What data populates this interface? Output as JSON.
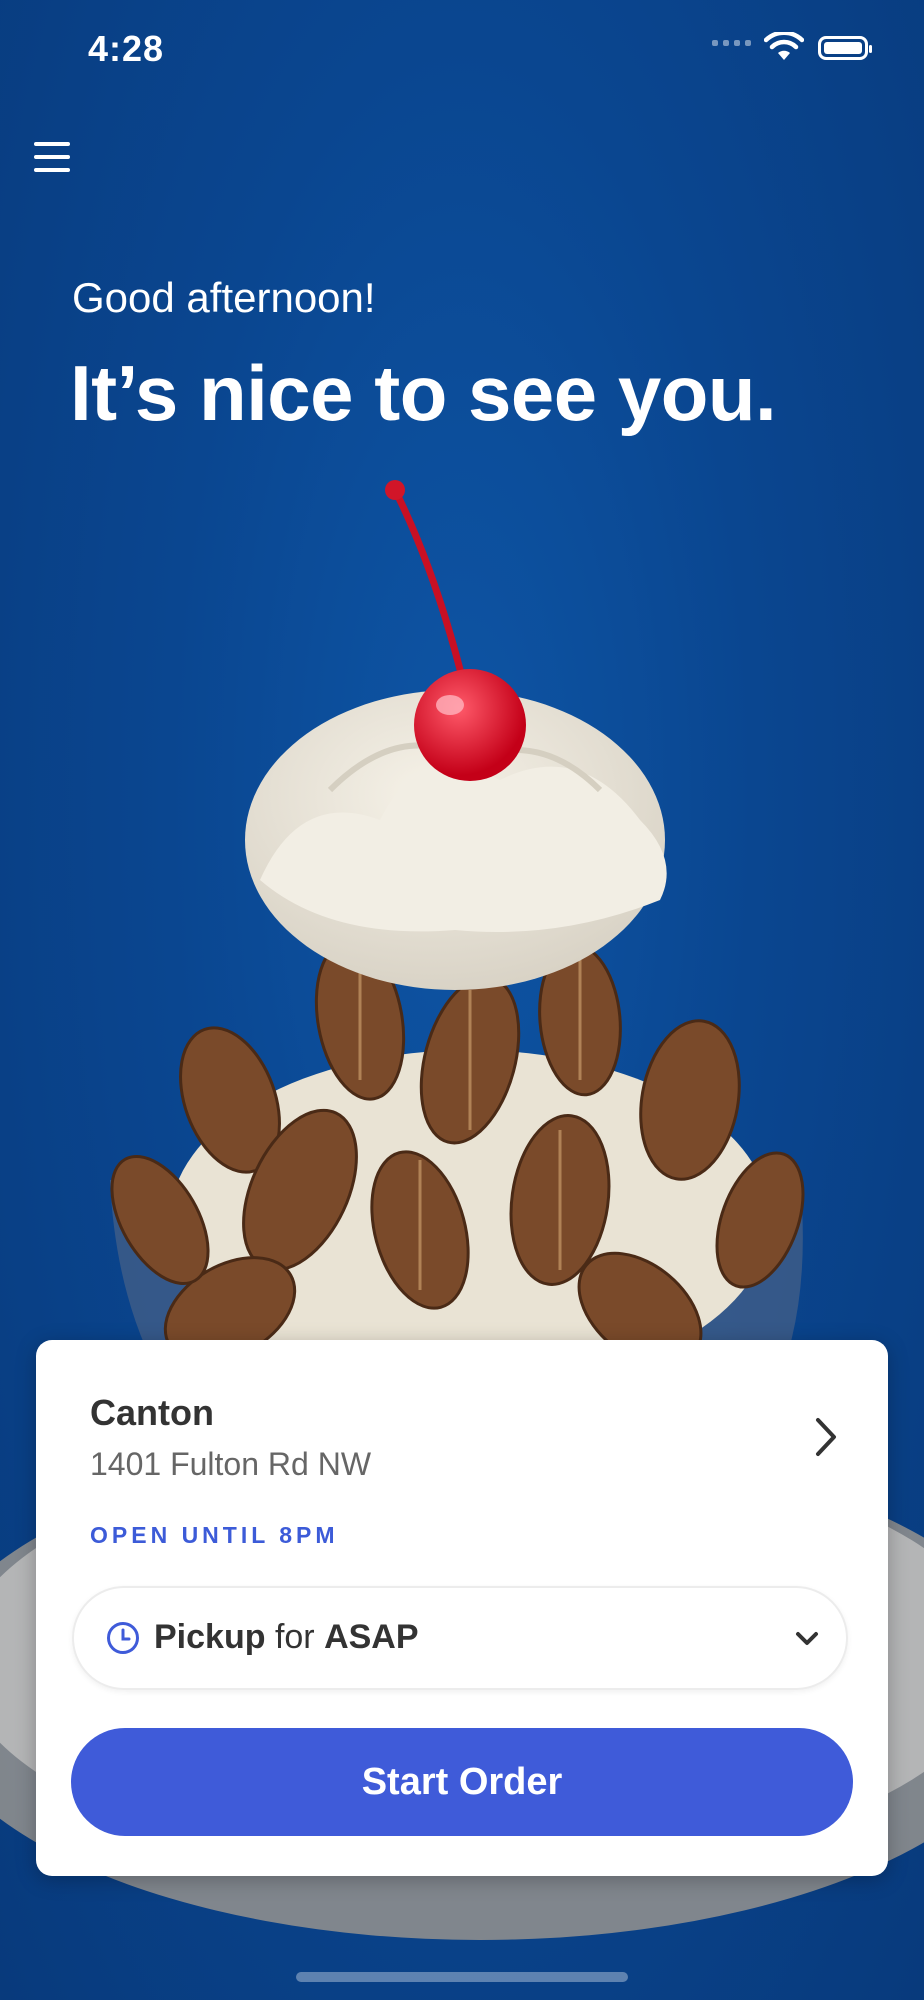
{
  "status_bar": {
    "time": "4:28"
  },
  "greeting": "Good afternoon!",
  "headline": "It’s nice to see you.",
  "location": {
    "name": "Canton",
    "address": "1401 Fulton Rd NW",
    "hours": "OPEN UNTIL 8PM"
  },
  "order_mode": {
    "mode": "Pickup",
    "connector": "for",
    "time": "ASAP"
  },
  "cta": {
    "label": "Start Order"
  },
  "colors": {
    "background": "#0b4a93",
    "accent": "#3f5bd9",
    "card": "#ffffff"
  },
  "icons": [
    "menu-icon",
    "wifi-icon",
    "battery-icon",
    "chevron-right-icon",
    "clock-icon",
    "chevron-down-icon"
  ]
}
